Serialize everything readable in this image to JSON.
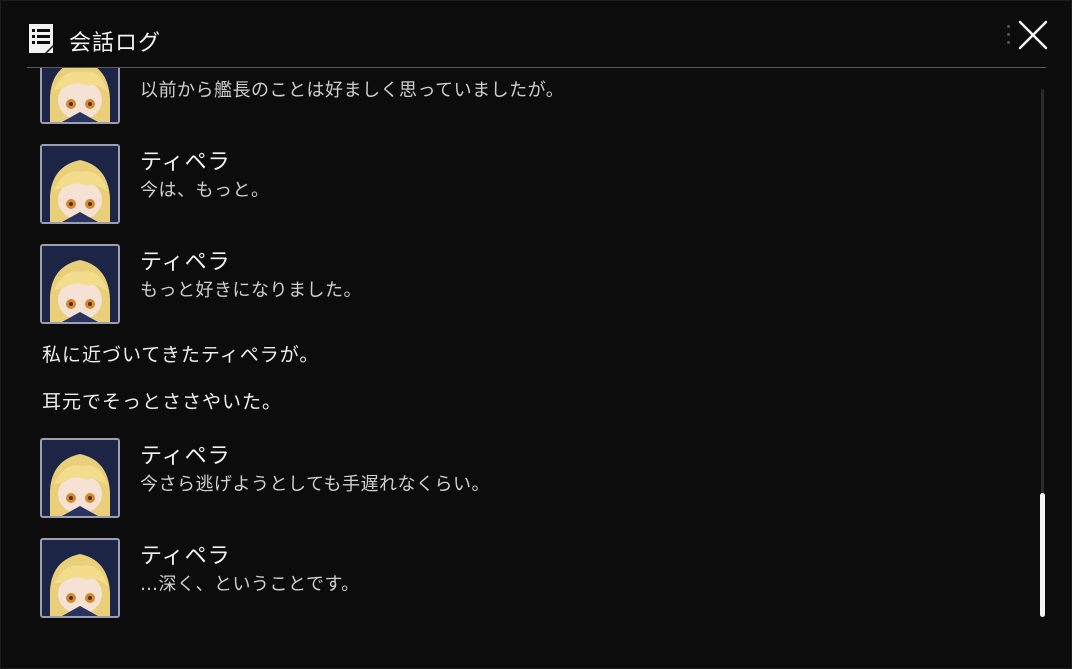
{
  "header": {
    "title": "会話ログ",
    "icon": "log-document-icon",
    "close_icon": "close-icon"
  },
  "log": {
    "entries": [
      {
        "speaker": "",
        "text": "以前から艦長のことは好ましく思っていましたが。"
      },
      {
        "speaker": "ティペラ",
        "text": "今は、もっと。"
      },
      {
        "speaker": "ティペラ",
        "text": "もっと好きになりました。"
      },
      {
        "narration": "私に近づいてきたティペラが。"
      },
      {
        "narration": "耳元でそっとささやいた。"
      },
      {
        "speaker": "ティペラ",
        "text": "今さら逃げようとしても手遅れなくらい。"
      },
      {
        "speaker": "ティペラ",
        "text": "…深く、ということです。"
      }
    ]
  },
  "colors": {
    "background": "#0c0c0c",
    "divider": "#5a5a5a",
    "portrait_border": "#9aa0b2",
    "scroll_thumb": "#f4f4f4"
  }
}
